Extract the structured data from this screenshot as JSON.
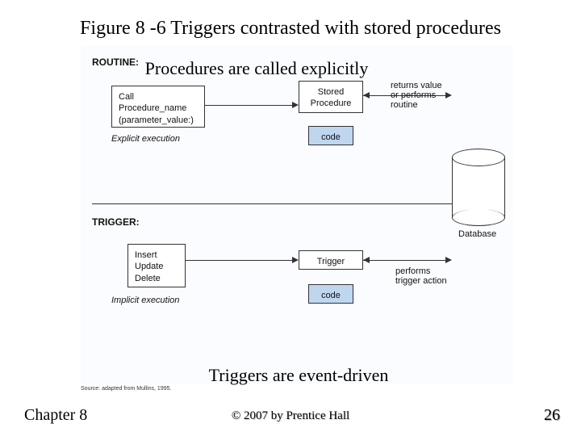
{
  "title": "Figure 8 -6 Triggers contrasted with stored procedures",
  "routine": {
    "section_label": "ROUTINE:",
    "annotation": "Procedures are called explicitly",
    "call_box": "Call\nProcedure_name\n(parameter_value:)",
    "stored_box": "Stored\nProcedure",
    "code_label": "code",
    "explicit_label": "Explicit execution",
    "returns_label": "returns value\nor performs\nroutine"
  },
  "trigger": {
    "section_label": "TRIGGER:",
    "annotation": "Triggers are event-driven",
    "events_box": "Insert\nUpdate\nDelete",
    "trigger_box": "Trigger",
    "code_label": "code",
    "implicit_label": "Implicit execution",
    "performs_label": "performs\ntrigger action",
    "db_label": "Database"
  },
  "source_attrib": "Source: adapted from Mullins, 1995.",
  "footer": {
    "left": "Chapter 8",
    "center": "© 2007 by Prentice Hall",
    "right": "26"
  }
}
